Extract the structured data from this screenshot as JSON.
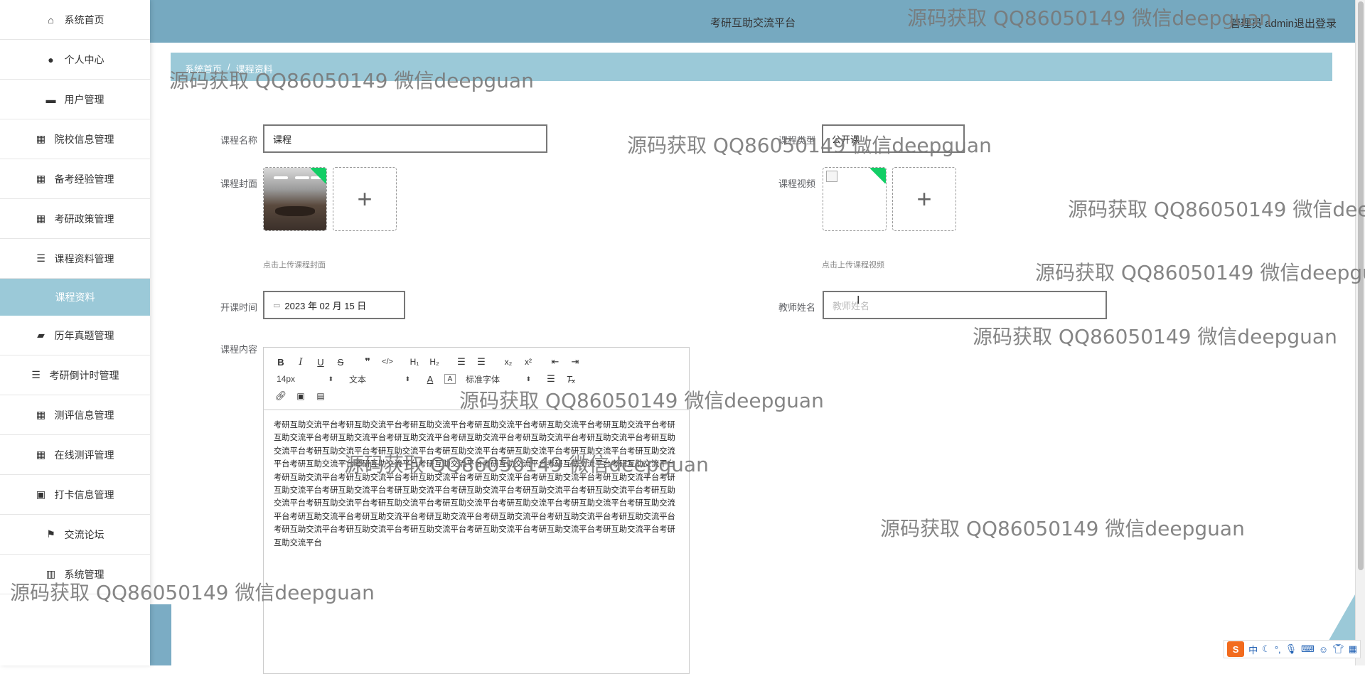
{
  "header": {
    "title": "考研互助交流平台",
    "user": "管理员 admin",
    "logout": "退出登录"
  },
  "sidebar": {
    "items": [
      {
        "label": "系统首页",
        "icon": "home-icon"
      },
      {
        "label": "个人中心",
        "icon": "user-icon"
      },
      {
        "label": "用户管理",
        "icon": "users-icon"
      },
      {
        "label": "院校信息管理",
        "icon": "grid-icon"
      },
      {
        "label": "备考经验管理",
        "icon": "grid-icon"
      },
      {
        "label": "考研政策管理",
        "icon": "grid-icon"
      },
      {
        "label": "课程资料管理",
        "icon": "list-icon"
      },
      {
        "label": "课程资料",
        "icon": "",
        "active": true
      },
      {
        "label": "历年真题管理",
        "icon": "wallet-icon"
      },
      {
        "label": "考研倒计时管理",
        "icon": "list-icon"
      },
      {
        "label": "测评信息管理",
        "icon": "grid-icon"
      },
      {
        "label": "在线测评管理",
        "icon": "grid-icon"
      },
      {
        "label": "打卡信息管理",
        "icon": "clipboard-icon"
      },
      {
        "label": "交流论坛",
        "icon": "flag-icon"
      },
      {
        "label": "系统管理",
        "icon": "book-icon"
      }
    ]
  },
  "breadcrumb": {
    "home": "系统首页",
    "sep": "/",
    "current": "课程资料"
  },
  "form": {
    "course_name_label": "课程名称",
    "course_name_value": "课程",
    "course_type_label": "课程类型",
    "course_type_value": "公开课",
    "cover_label": "课程封面",
    "cover_hint": "点击上传课程封面",
    "video_label": "课程视频",
    "video_hint": "点击上传课程视频",
    "start_time_label": "开课时间",
    "start_time_value": "2023 年 02 月 15 日",
    "teacher_label": "教师姓名",
    "teacher_placeholder": "教师姓名",
    "content_label": "课程内容",
    "plus": "+"
  },
  "editor": {
    "font_size": "14px",
    "paragraph": "文本",
    "font_family": "标准字体",
    "content": "考研互助交流平台考研互助交流平台考研互助交流平台考研互助交流平台考研互助交流平台考研互助交流平台考研互助交流平台考研互助交流平台考研互助交流平台考研互助交流平台考研互助交流平台考研互助交流平台考研互助交流平台考研互助交流平台考研互助交流平台考研互助交流平台考研互助交流平台考研互助交流平台考研互助交流平台考研互助交流平台考研互助交流平台考研互助交流平台考研互助交流平台考研互助交流平台考研互助交流平台考研互助交流平台考研互助交流平台考研互助交流平台考研互助交流平台考研互助交流平台考研互助交流平台考研互助交流平台考研互助交流平台考研互助交流平台考研互助交流平台考研互助交流平台考研互助交流平台考研互助交流平台考研互助交流平台考研互助交流平台考研互助交流平台考研互助交流平台考研互助交流平台考研互助交流平台考研互助交流平台考研互助交流平台考研互助交流平台考研互助交流平台考研互助交流平台考研互助交流平台考研互助交流平台考研互助交流平台考研互助交流平台考研互助交流平台考研互助交流平台考研互助交流平台考研互助交流平台"
  },
  "watermark": "源码获取 QQ86050149 微信deepguan",
  "ime": {
    "lang": "中"
  }
}
